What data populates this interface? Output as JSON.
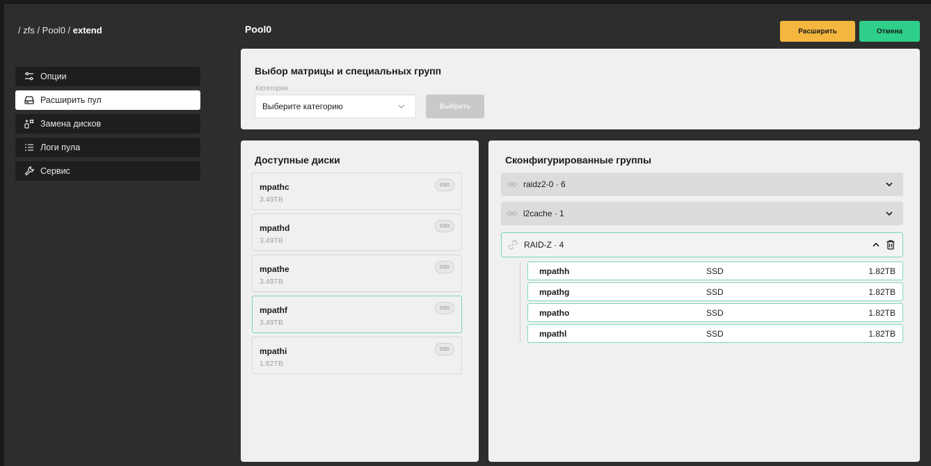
{
  "breadcrumb": {
    "path": "/ zfs / Pool0 / ",
    "current": "extend"
  },
  "sidebar": {
    "items": [
      {
        "label": "Опции",
        "icon": "sliders-icon",
        "active": false
      },
      {
        "label": "Расширить пул",
        "icon": "drive-icon",
        "active": true
      },
      {
        "label": "Замена дисков",
        "icon": "swap-disks-icon",
        "active": false
      },
      {
        "label": "Логи пула",
        "icon": "list-icon",
        "active": false
      },
      {
        "label": "Сервис",
        "icon": "wrench-icon",
        "active": false
      }
    ]
  },
  "header": {
    "title": "Pool0",
    "expand_label": "Расширить",
    "cancel_label": "Отмена"
  },
  "matrix": {
    "title": "Выбор матрицы и специальных групп",
    "category_label": "Категория",
    "category_placeholder": "Выберите категорию",
    "choose_label": "Выбрать"
  },
  "available": {
    "title": "Доступные диски",
    "disks": [
      {
        "name": "mpathc",
        "size": "3.49TB",
        "type": "SSD"
      },
      {
        "name": "mpathd",
        "size": "3.49TB",
        "type": "SSD"
      },
      {
        "name": "mpathe",
        "size": "3.49TB",
        "type": "SSD"
      },
      {
        "name": "mpathf",
        "size": "3.49TB",
        "type": "SSD"
      },
      {
        "name": "mpathi",
        "size": "1.82TB",
        "type": "SSD"
      }
    ]
  },
  "configured": {
    "title": "Сконфигурированные группы",
    "groups": [
      {
        "label": "raidz2-0 · 6"
      },
      {
        "label": "l2cache · 1"
      },
      {
        "label": "RAID-Z · 4"
      }
    ],
    "members": [
      {
        "name": "mpathh",
        "type": "SSD",
        "size": "1.82TB"
      },
      {
        "name": "mpathg",
        "type": "SSD",
        "size": "1.82TB"
      },
      {
        "name": "mpatho",
        "type": "SSD",
        "size": "1.82TB"
      },
      {
        "name": "mpathl",
        "type": "SSD",
        "size": "1.82TB"
      }
    ]
  },
  "colors": {
    "accent_orange": "#f4b63e",
    "accent_green": "#2ecf8a",
    "selected_border": "#7ad9b1"
  }
}
